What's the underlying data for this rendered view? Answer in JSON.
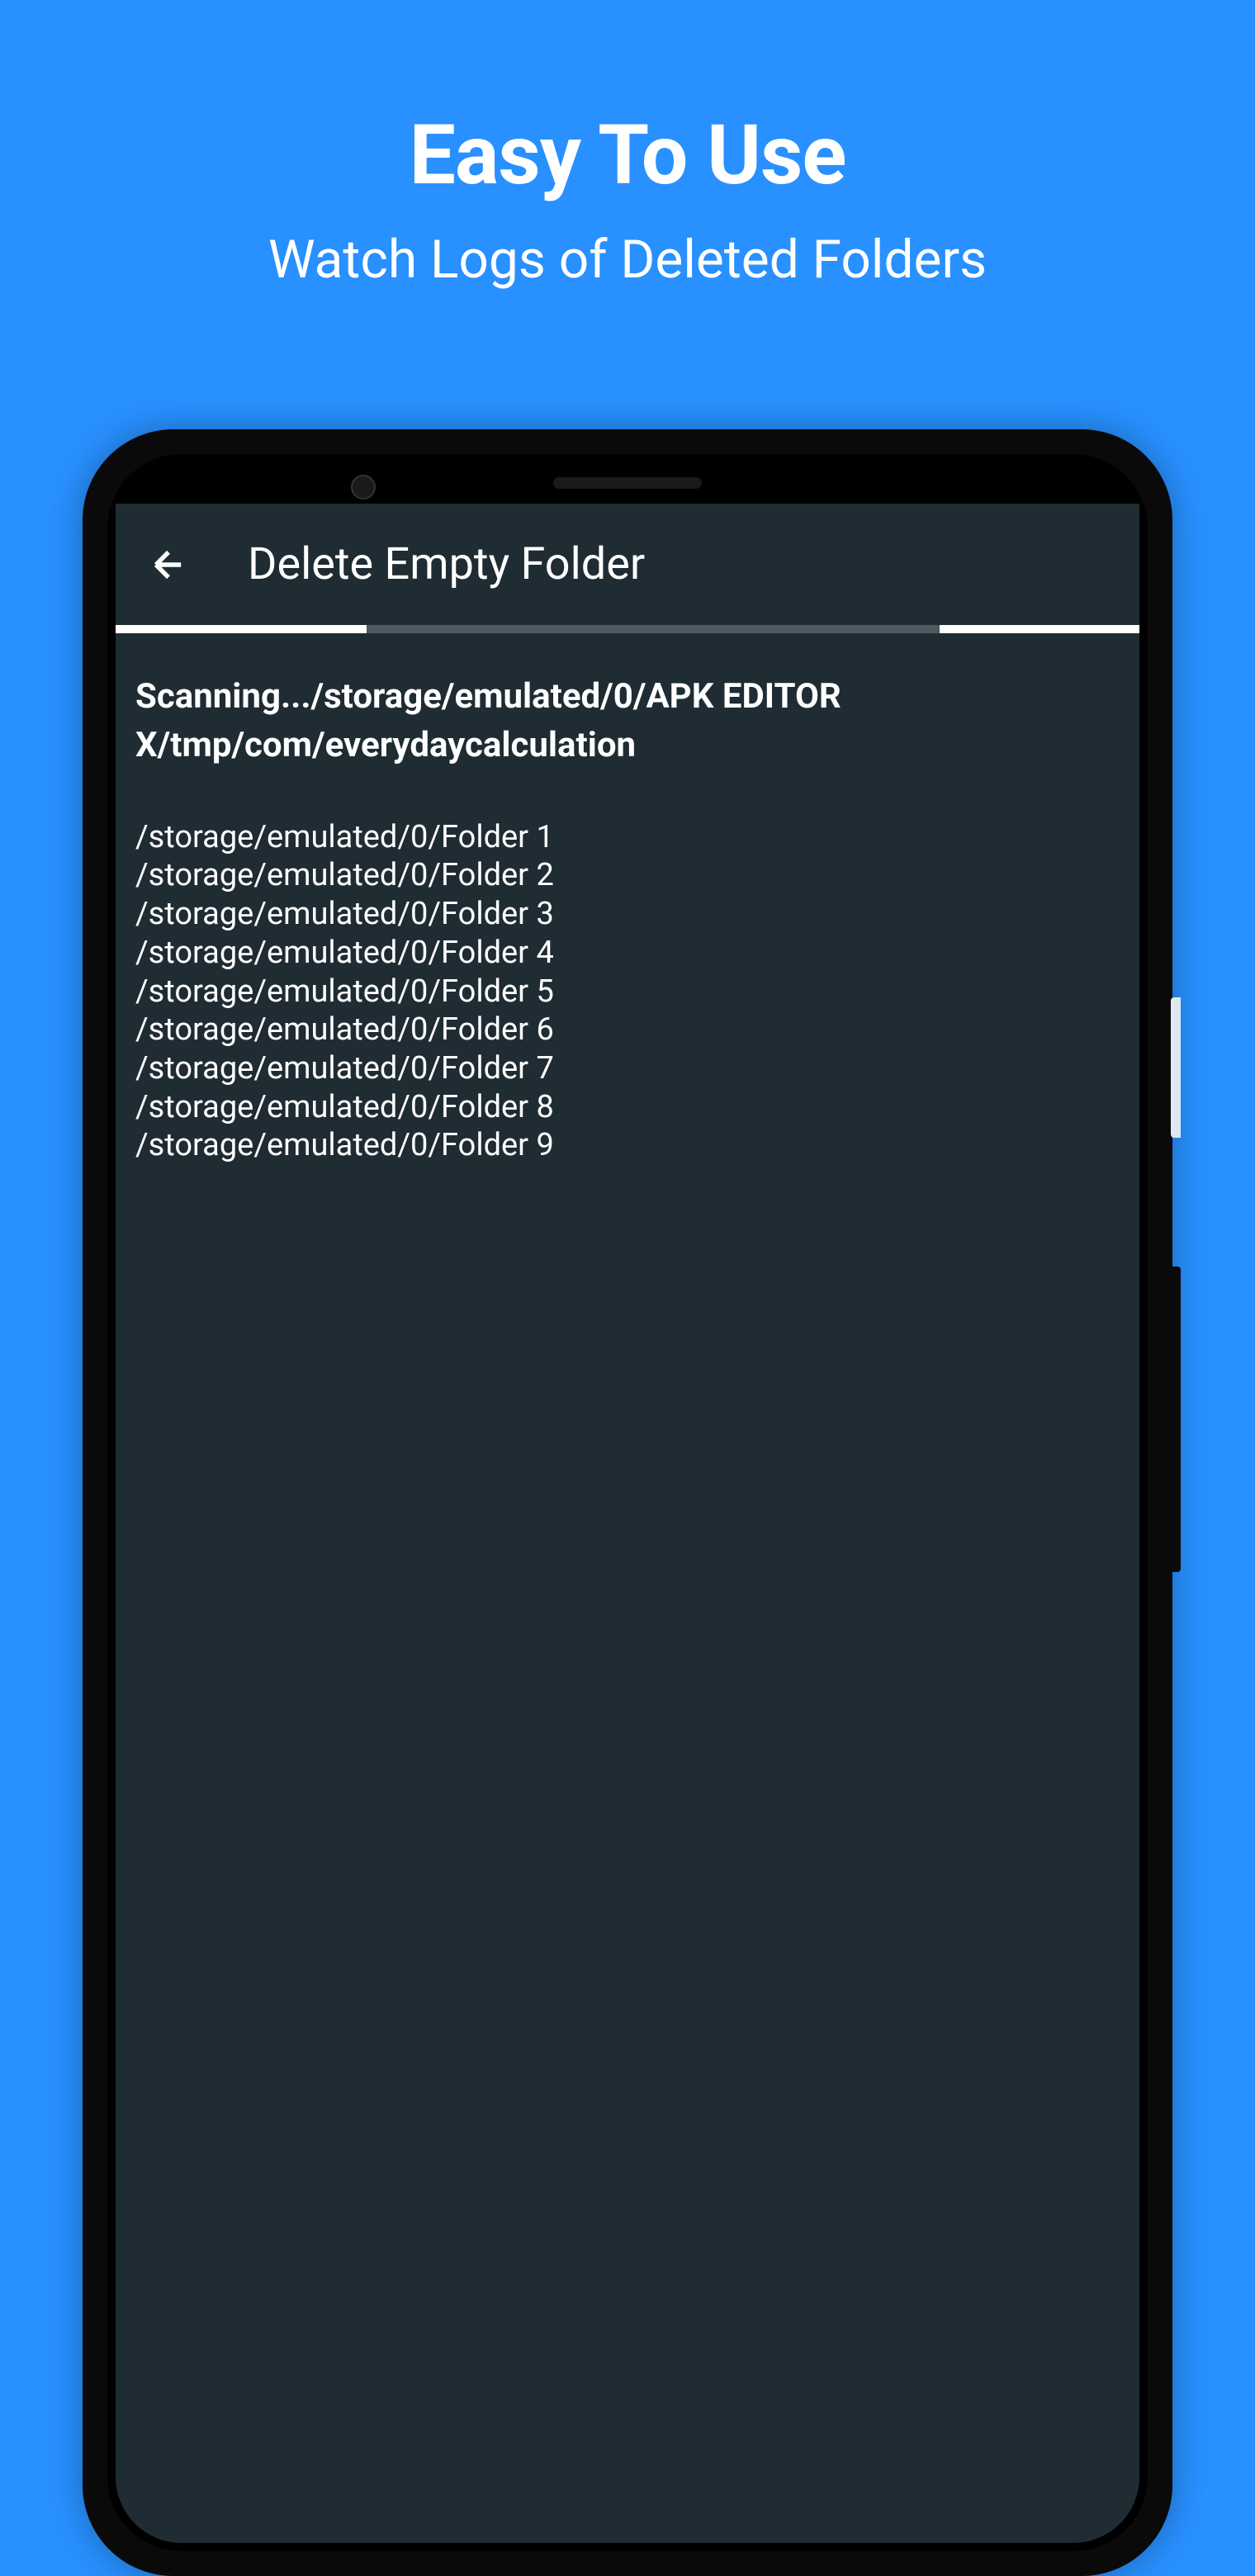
{
  "promo": {
    "title": "Easy To Use",
    "subtitle": "Watch Logs of Deleted Folders"
  },
  "app": {
    "title": "Delete Empty Folder",
    "scanning_text": "Scanning.../storage/emulated/0/APK EDITOR X/tmp/com/everydaycalculation",
    "logs": [
      "/storage/emulated/0/Folder 1",
      "/storage/emulated/0/Folder 2",
      "/storage/emulated/0/Folder 3",
      "/storage/emulated/0/Folder 4",
      "/storage/emulated/0/Folder 5",
      "/storage/emulated/0/Folder 6",
      "/storage/emulated/0/Folder 7",
      "/storage/emulated/0/Folder 8",
      "/storage/emulated/0/Folder 9"
    ]
  }
}
